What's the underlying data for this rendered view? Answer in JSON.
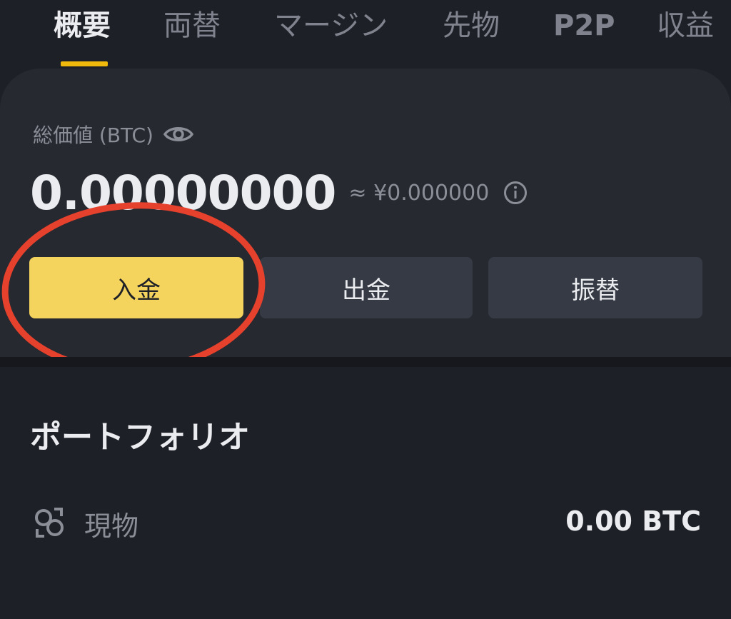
{
  "tabs": [
    {
      "label": "概要",
      "active": true
    },
    {
      "label": "両替",
      "active": false
    },
    {
      "label": "マージン",
      "active": false
    },
    {
      "label": "先物",
      "active": false
    },
    {
      "label": "P2P",
      "active": false
    },
    {
      "label": "収益",
      "active": false
    }
  ],
  "balance": {
    "label": "総価値 (BTC)",
    "value": "0.00000000",
    "fiat": "≈ ¥0.000000",
    "eye_icon": "eye-icon",
    "info_icon": "info-icon"
  },
  "actions": {
    "deposit": "入金",
    "withdraw": "出金",
    "transfer": "振替"
  },
  "portfolio": {
    "title": "ポートフォリオ",
    "rows": [
      {
        "icon": "spot-icon",
        "label": "現物",
        "value": "0.00 BTC"
      }
    ]
  },
  "colors": {
    "accent": "#f0b90b",
    "deposit_button": "#f5d45d",
    "highlight_oval": "#e5412c",
    "background": "#1e2027",
    "card": "#262930"
  }
}
